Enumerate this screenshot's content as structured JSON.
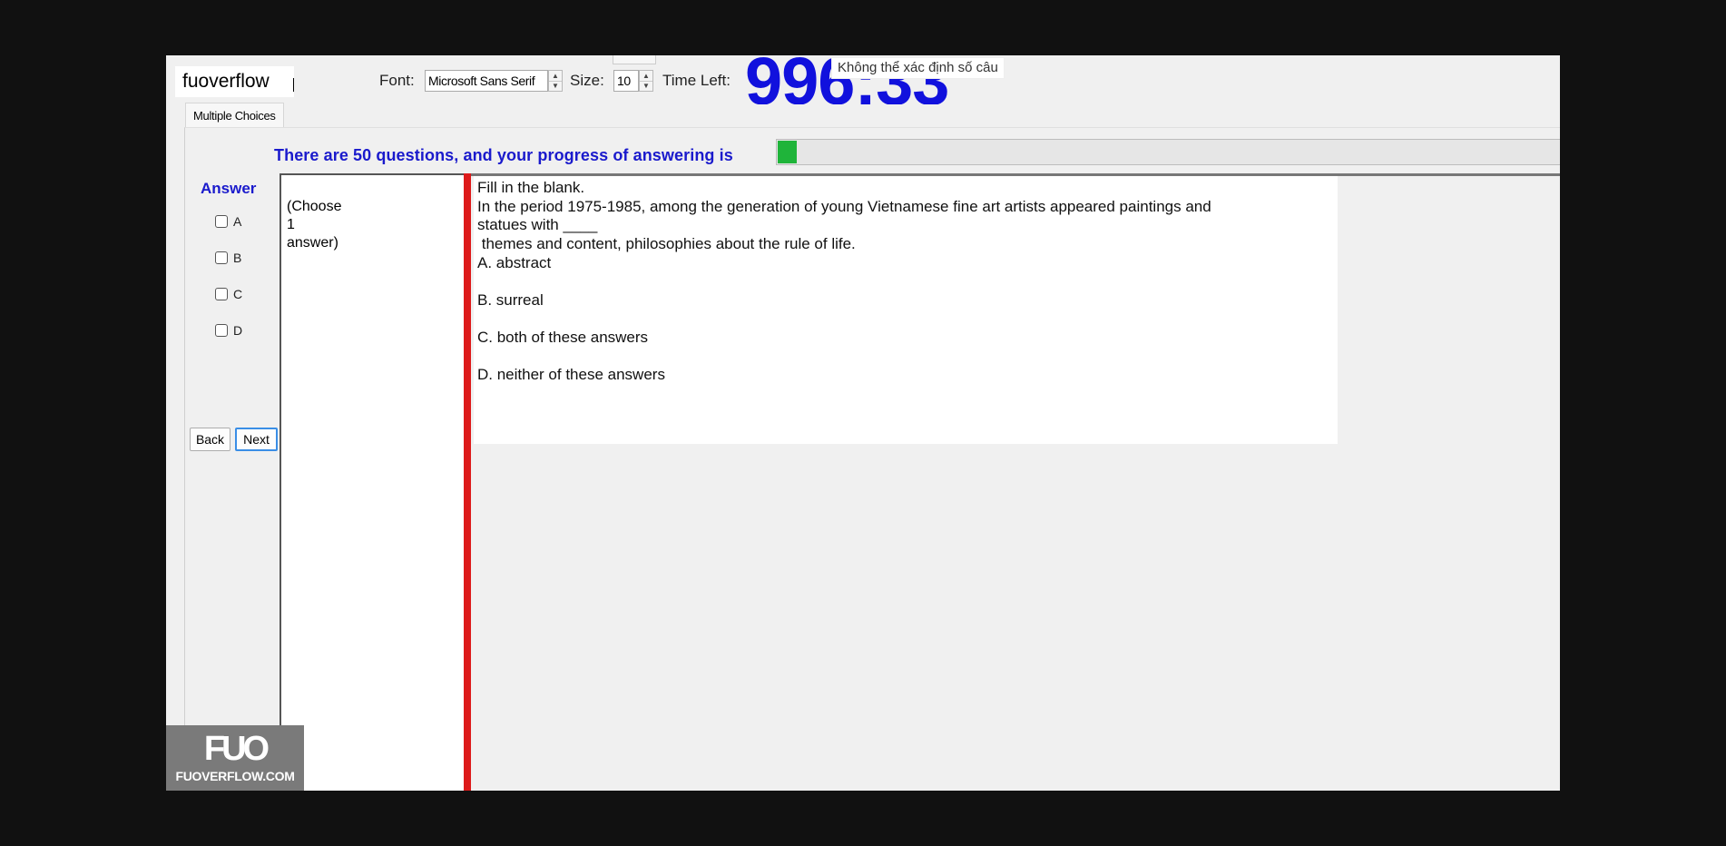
{
  "brand": {
    "text": "fuoverflow"
  },
  "toolbar": {
    "font_label": "Font:",
    "font_value": "Microsoft Sans Serif",
    "size_label": "Size:",
    "size_value": "10",
    "time_left_label": "Time Left:",
    "timer_value": "996:33"
  },
  "tooltip": {
    "text": "Không thể xác định số câu"
  },
  "tab": {
    "label": "Multiple Choices"
  },
  "progress": {
    "text": "There are 50 questions, and your progress of answering is",
    "fraction": 0.024,
    "color": "#1fb43a"
  },
  "answer_panel": {
    "title": "Answer",
    "options": [
      "A",
      "B",
      "C",
      "D"
    ],
    "back_label": "Back",
    "next_label": "Next"
  },
  "question_list": {
    "line1": "(Choose",
    "line2": "1",
    "line3": "answer)"
  },
  "question": {
    "line1": "Fill in the blank.",
    "line2": "In the period 1975-1985, among the generation of young Vietnamese fine art artists appeared paintings and",
    "line3": "statues with ____",
    "line4": " themes and content, philosophies about the rule of life.",
    "answers": [
      "A.  abstract",
      "B.  surreal",
      "C.  both of these answers",
      "D.  neither of these answers"
    ]
  },
  "watermark": {
    "logo": "FUO",
    "url": "FUOVERFLOW.COM"
  },
  "colors": {
    "accent_blue": "#1a1acc",
    "divider_red": "#dd1a1a"
  }
}
